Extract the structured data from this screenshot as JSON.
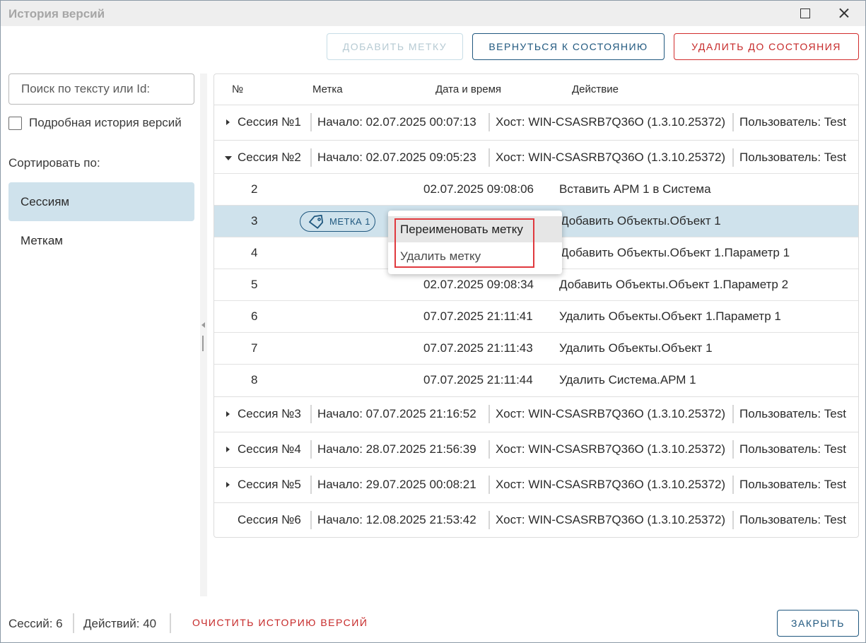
{
  "window": {
    "title": "История версий"
  },
  "toolbar": {
    "add_tag_label": "ДОБАВИТЬ МЕТКУ",
    "return_label": "ВЕРНУТЬСЯ К СОСТОЯНИЮ",
    "delete_label": "УДАЛИТЬ ДО СОСТОЯНИЯ"
  },
  "sidebar": {
    "search_placeholder": "Поиск по тексту или Id:",
    "detailed_label": "Подробная история версий",
    "detailed_checked": false,
    "sort_label": "Сортировать по:",
    "sort_options": [
      "Сессиям",
      "Меткам"
    ],
    "selected_sort": "Сессиям"
  },
  "grid": {
    "headers": {
      "num": "№",
      "tag": "Метка",
      "datetime": "Дата и время",
      "action": "Действие"
    },
    "sessions": [
      {
        "name": "Сессия №1",
        "start": "Начало: 02.07.2025 00:07:13",
        "host": "Хост: WIN-CSASRB7Q36O (1.3.10.25372)",
        "user": "Пользователь: Test",
        "expanded": false
      },
      {
        "name": "Сессия №2",
        "start": "Начало: 02.07.2025 09:05:23",
        "host": "Хост: WIN-CSASRB7Q36O (1.3.10.25372)",
        "user": "Пользователь: Test",
        "expanded": true
      },
      {
        "name": "Сессия №3",
        "start": "Начало: 07.07.2025 21:16:52",
        "host": "Хост: WIN-CSASRB7Q36O (1.3.10.25372)",
        "user": "Пользователь: Test",
        "expanded": false
      },
      {
        "name": "Сессия №4",
        "start": "Начало: 28.07.2025 21:56:39",
        "host": "Хост: WIN-CSASRB7Q36O (1.3.10.25372)",
        "user": "Пользователь: Test",
        "expanded": false
      },
      {
        "name": "Сессия №5",
        "start": "Начало: 29.07.2025 00:08:21",
        "host": "Хост: WIN-CSASRB7Q36O (1.3.10.25372)",
        "user": "Пользователь: Test",
        "expanded": false
      },
      {
        "name": "Сессия №6",
        "start": "Начало: 12.08.2025 21:53:42",
        "host": "Хост: WIN-CSASRB7Q36O (1.3.10.25372)",
        "user": "Пользователь: Test",
        "expanded": false
      }
    ],
    "actions": [
      {
        "num": "2",
        "tag": "",
        "datetime": "02.07.2025 09:08:06",
        "action": "Вставить АРМ 1 в Система"
      },
      {
        "num": "3",
        "tag": "МЕТКА 1",
        "datetime": "",
        "action": "Добавить Объекты.Объект 1",
        "selected": true
      },
      {
        "num": "4",
        "tag": "",
        "datetime": "",
        "action": "Добавить Объекты.Объект 1.Параметр 1"
      },
      {
        "num": "5",
        "tag": "",
        "datetime": "02.07.2025 09:08:34",
        "action": "Добавить Объекты.Объект 1.Параметр 2"
      },
      {
        "num": "6",
        "tag": "",
        "datetime": "07.07.2025 21:11:41",
        "action": "Удалить Объекты.Объект 1.Параметр 1"
      },
      {
        "num": "7",
        "tag": "",
        "datetime": "07.07.2025 21:11:43",
        "action": "Удалить Объекты.Объект 1"
      },
      {
        "num": "8",
        "tag": "",
        "datetime": "07.07.2025 21:11:44",
        "action": "Удалить Система.АРМ 1"
      }
    ]
  },
  "context_menu": {
    "rename": "Переименовать метку",
    "remove": "Удалить метку"
  },
  "footer": {
    "sessions": "Сессий: 6",
    "actions": "Действий: 40",
    "clear_label": "ОЧИСТИТЬ ИСТОРИЮ ВЕРСИЙ",
    "close_label": "ЗАКРЫТЬ"
  },
  "colors": {
    "accent": "#20587f",
    "danger": "#c62828",
    "selection": "#cfe2ec",
    "highlight": "#e0393e"
  },
  "icons": {
    "tag": "tag-icon",
    "expand": "chevron-right-icon",
    "collapse": "chevron-down-icon"
  }
}
